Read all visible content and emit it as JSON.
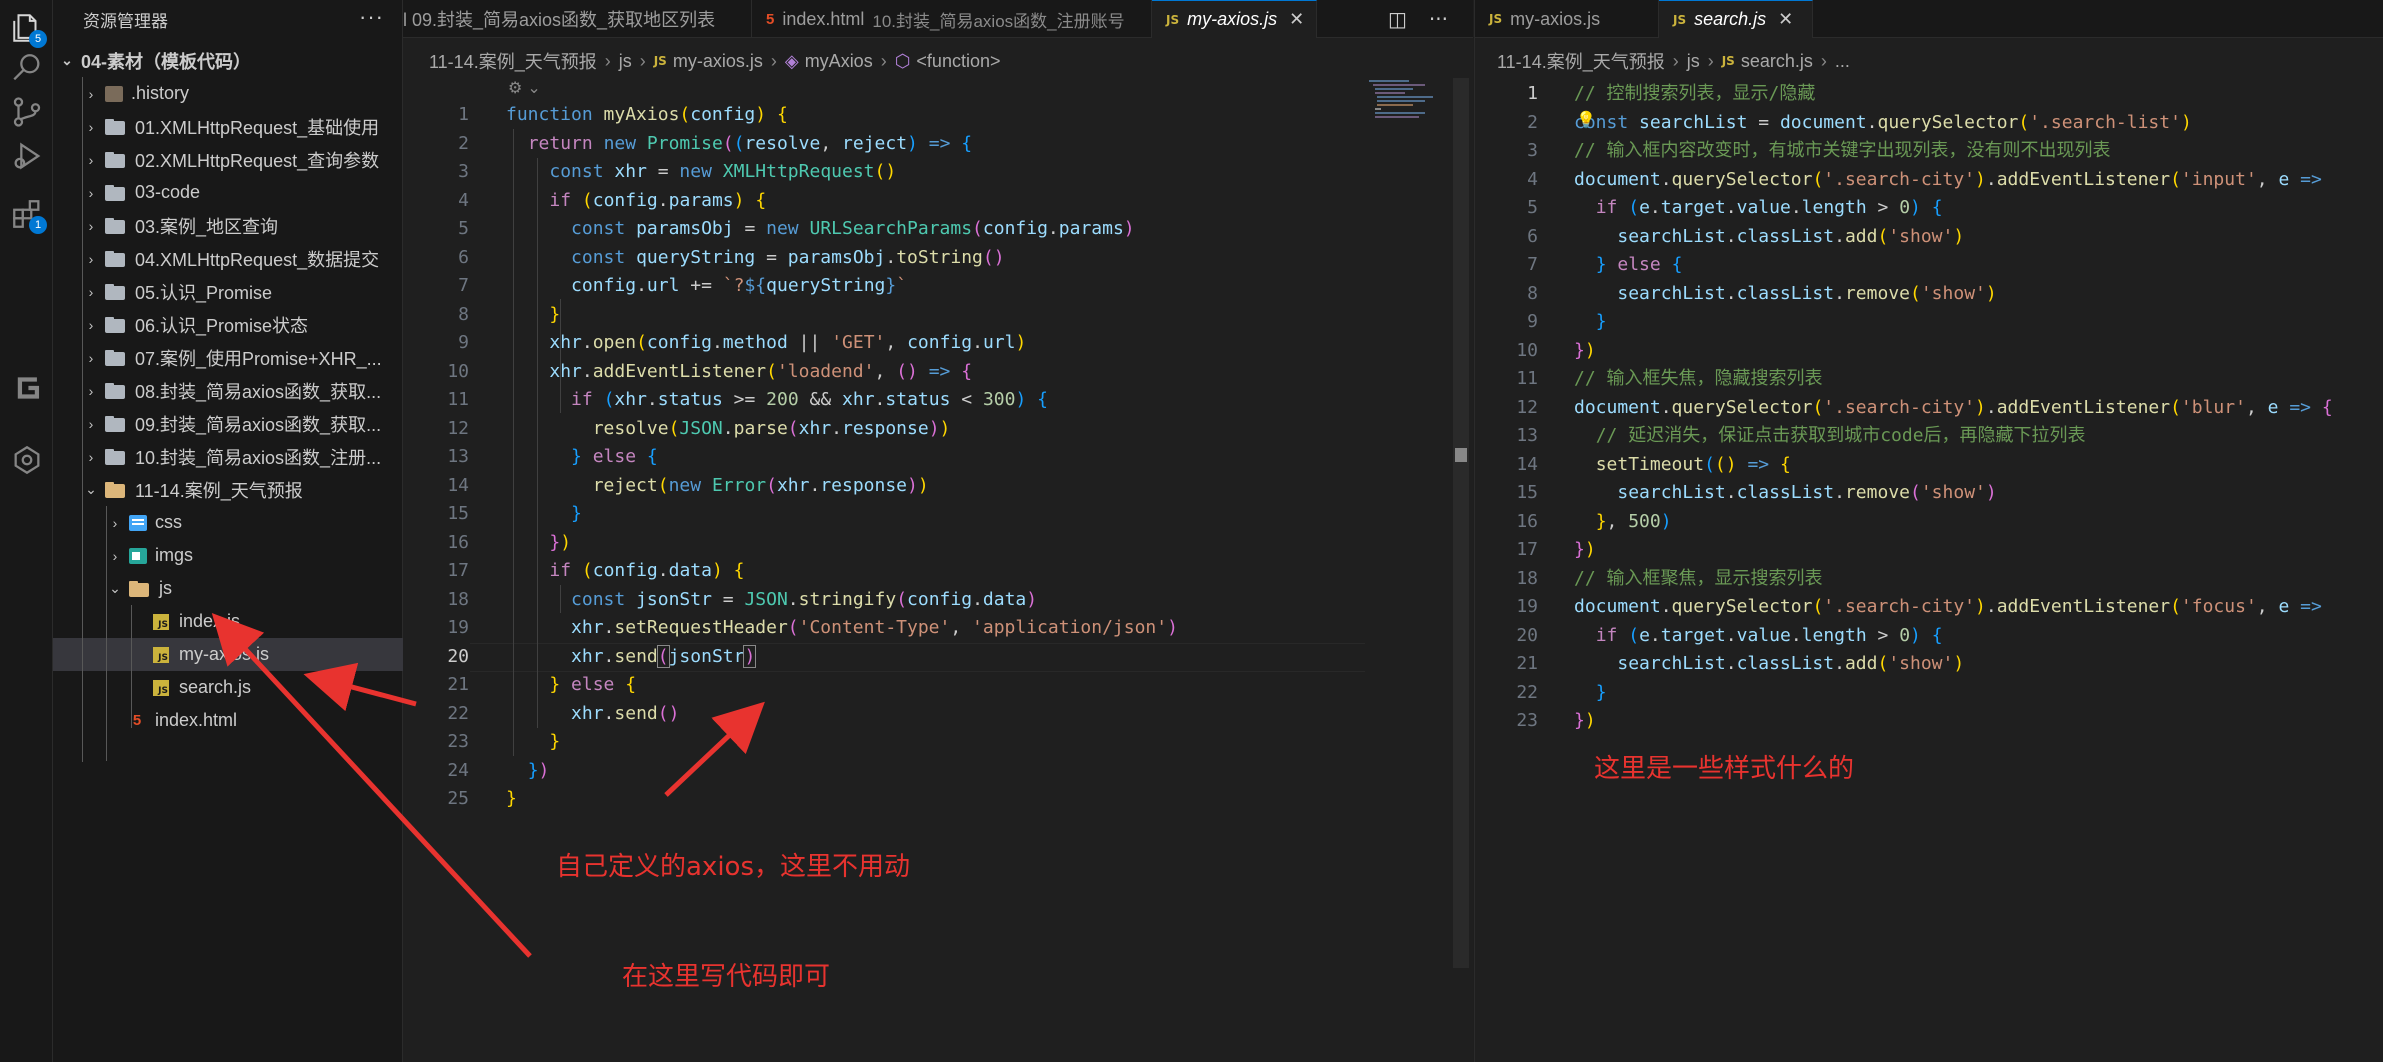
{
  "activity_bar": {
    "items": [
      {
        "icon": "explorer-icon",
        "badge": "5"
      },
      {
        "icon": "search-icon"
      },
      {
        "icon": "source-control-icon"
      },
      {
        "icon": "run-debug-icon"
      },
      {
        "icon": "extensions-icon",
        "badge": "1"
      },
      {
        "icon": "gitlens-icon"
      },
      {
        "icon": "remote-icon"
      }
    ]
  },
  "sidebar": {
    "title": "资源管理器",
    "more": "···",
    "root": "04-素材（模板代码）",
    "items": [
      {
        "label": ".history",
        "kind": "folder"
      },
      {
        "label": "01.XMLHttpRequest_基础使用",
        "kind": "folder"
      },
      {
        "label": "02.XMLHttpRequest_查询参数",
        "kind": "folder"
      },
      {
        "label": "03-code",
        "kind": "folder"
      },
      {
        "label": "03.案例_地区查询",
        "kind": "folder"
      },
      {
        "label": "04.XMLHttpRequest_数据提交",
        "kind": "folder"
      },
      {
        "label": "05.认识_Promise",
        "kind": "folder"
      },
      {
        "label": "06.认识_Promise状态",
        "kind": "folder"
      },
      {
        "label": "07.案例_使用Promise+XHR_...",
        "kind": "folder"
      },
      {
        "label": "08.封装_简易axios函数_获取...",
        "kind": "folder"
      },
      {
        "label": "09.封装_简易axios函数_获取...",
        "kind": "folder"
      },
      {
        "label": "10.封装_简易axios函数_注册...",
        "kind": "folder"
      },
      {
        "label": "11-14.案例_天气预报",
        "kind": "folder-open"
      },
      {
        "label": "css",
        "kind": "css"
      },
      {
        "label": "imgs",
        "kind": "img"
      },
      {
        "label": "js",
        "kind": "folder-open"
      },
      {
        "label": "index.js",
        "kind": "js"
      },
      {
        "label": "my-axios.js",
        "kind": "js"
      },
      {
        "label": "search.js",
        "kind": "js"
      },
      {
        "label": "index.html",
        "kind": "html"
      }
    ]
  },
  "editor_left": {
    "tabs": [
      {
        "label": "l 09.封装_简易axios函数_获取地区列表",
        "sub": ""
      },
      {
        "label": "index.html",
        "sub": "10.封装_简易axios函数_注册账号"
      },
      {
        "label": "my-axios.js",
        "sub": ""
      }
    ],
    "breadcrumb": [
      "11-14.案例_天气预报",
      "js",
      "my-axios.js",
      "myAxios",
      "<function>"
    ],
    "current_line": 20,
    "line_numbers": [
      "1",
      "2",
      "3",
      "4",
      "5",
      "6",
      "7",
      "8",
      "9",
      "10",
      "11",
      "12",
      "13",
      "14",
      "15",
      "16",
      "17",
      "18",
      "19",
      "20",
      "21",
      "22",
      "23",
      "24",
      "25"
    ]
  },
  "editor_right": {
    "tabs": [
      {
        "label": "my-axios.js"
      },
      {
        "label": "search.js"
      }
    ],
    "breadcrumb": [
      "11-14.案例_天气预报",
      "js",
      "search.js",
      "..."
    ],
    "line_numbers": [
      "1",
      "2",
      "3",
      "4",
      "5",
      "6",
      "7",
      "8",
      "9",
      "10",
      "11",
      "12",
      "13",
      "14",
      "15",
      "16",
      "17",
      "18",
      "19",
      "20",
      "21",
      "22",
      "23"
    ]
  },
  "annotations": {
    "custom_axios": "自己定义的axios，这里不用动",
    "write_here": "在这里写代码即可",
    "styles_note": "这里是一些样式什么的"
  },
  "colors": {
    "annotation_red": "#e8332f",
    "accent": "#0078d4"
  }
}
